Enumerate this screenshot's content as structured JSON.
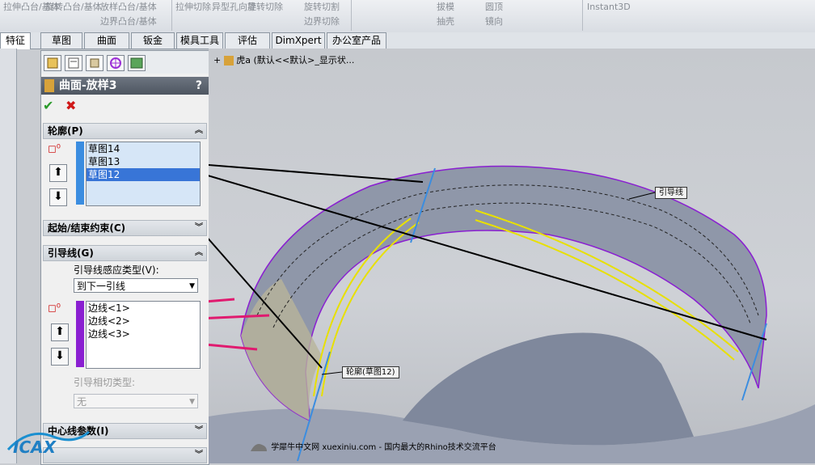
{
  "ribbon": {
    "items": [
      "拉伸凸台/基体",
      "旋转凸台/基体",
      "放样凸台/基体",
      "边界凸台/基体",
      "拉伸切除",
      "异型孔向导",
      "旋转切除",
      "旋转切割",
      "边界切除",
      "拔模",
      "圆顶",
      "抽壳",
      "镜向",
      "Instant3D"
    ]
  },
  "tabs": [
    "特征",
    "草图",
    "曲面",
    "钣金",
    "模具工具",
    "评估",
    "DimXpert",
    "办公室产品"
  ],
  "tree": {
    "root": "虎a (默认<<默认>_显示状..."
  },
  "panel": {
    "title": "曲面-放样3",
    "help": "?",
    "ok": "✔",
    "cancel": "✖",
    "profile_group": "轮廓(P)",
    "profiles": [
      "草图14",
      "草图13",
      "草图12"
    ],
    "selected_profile": 2,
    "startend_group": "起始/结束约束(C)",
    "guide_group": "引导线(G)",
    "guide_influence_label": "引导线感应类型(V):",
    "guide_influence_value": "到下一引线",
    "guides": [
      "边线<1>",
      "边线<2>",
      "边线<3>"
    ],
    "guide_tangent_label": "引导相切类型:",
    "guide_tangent_value": "无",
    "centerline_group": "中心线参数(I)"
  },
  "canvas": {
    "callout_guide": "引导线",
    "callout_profile": "轮廓(草图12)",
    "footer": "学犀牛中文网 xuexiniu.com - 国内最大的Rhino技术交流平台"
  },
  "watermark": "ICAX",
  "colors": {
    "accent": "#3875d7",
    "guide_line": "#e01a6f",
    "profile_line": "#000000",
    "surface": "#8b93a6"
  }
}
